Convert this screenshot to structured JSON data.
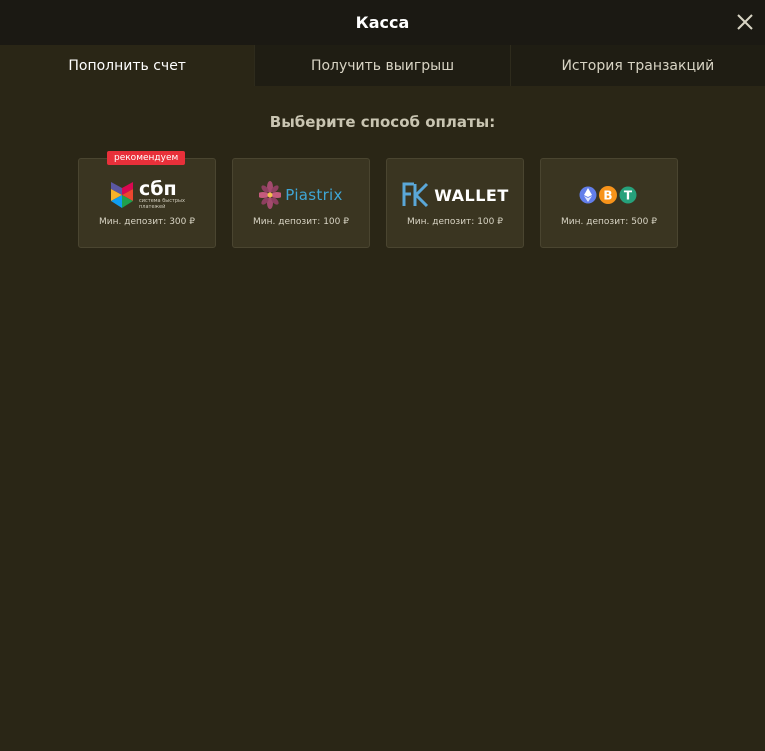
{
  "header": {
    "title": "Касса"
  },
  "tabs": [
    {
      "label": "Пополнить счет",
      "active": true
    },
    {
      "label": "Получить выигрыш",
      "active": false
    },
    {
      "label": "История транзакций",
      "active": false
    }
  ],
  "main": {
    "title": "Выберите способ оплаты:"
  },
  "methods": [
    {
      "logo_text": "сбп",
      "logo_subtext_1": "система быстрых",
      "logo_subtext_2": "платежей",
      "badge": "рекомендуем",
      "min_deposit": "Мин. депозит: 300 ₽",
      "icon": "sbp-logo-icon"
    },
    {
      "logo_text": "Piastrix",
      "min_deposit": "Мин. депозит: 100 ₽",
      "icon": "piastrix-flower-icon"
    },
    {
      "logo_text": "WALLET",
      "min_deposit": "Мин. депозит: 100 ₽",
      "icon": "fk-logo-icon"
    },
    {
      "min_deposit": "Мин. депозит: 500 ₽",
      "icon": "crypto-coins-icon"
    }
  ],
  "colors": {
    "background": "#2a2616",
    "header": "#1b1913",
    "card": "#3a3521",
    "badge": "#e8303a",
    "piastrix": "#3fa6d6"
  }
}
